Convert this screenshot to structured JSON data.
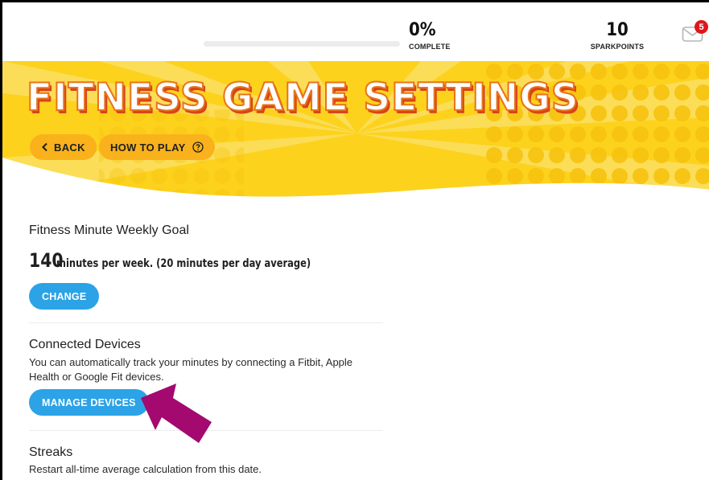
{
  "stats": {
    "progress_fraction": 0.0,
    "complete_value": "0%",
    "complete_label": "COMPLETE",
    "points_value": "10",
    "points_label": "SPARKPOINTS",
    "mail_badge": "5"
  },
  "banner": {
    "title": "FITNESS GAME SETTINGS",
    "back_label": "BACK",
    "how_label": "HOW TO PLAY"
  },
  "goal": {
    "title": "Fitness Minute Weekly Goal",
    "minutes": "140",
    "summary": "minutes per week. (20 minutes per day average)",
    "change_label": "CHANGE"
  },
  "devices": {
    "title": "Connected Devices",
    "description": "You can automatically track your minutes by connecting a Fitbit, Apple Health or Google Fit devices.",
    "manage_label": "MANAGE DEVICES"
  },
  "streaks": {
    "title": "Streaks",
    "description": "Restart all-time average calculation from this date."
  },
  "colors": {
    "banner_yellow": "#fcd21d",
    "pill_orange": "#f9b21c",
    "button_blue": "#2ba3e6",
    "arrow_magenta": "#a3096e",
    "badge_red": "#e0161b"
  }
}
